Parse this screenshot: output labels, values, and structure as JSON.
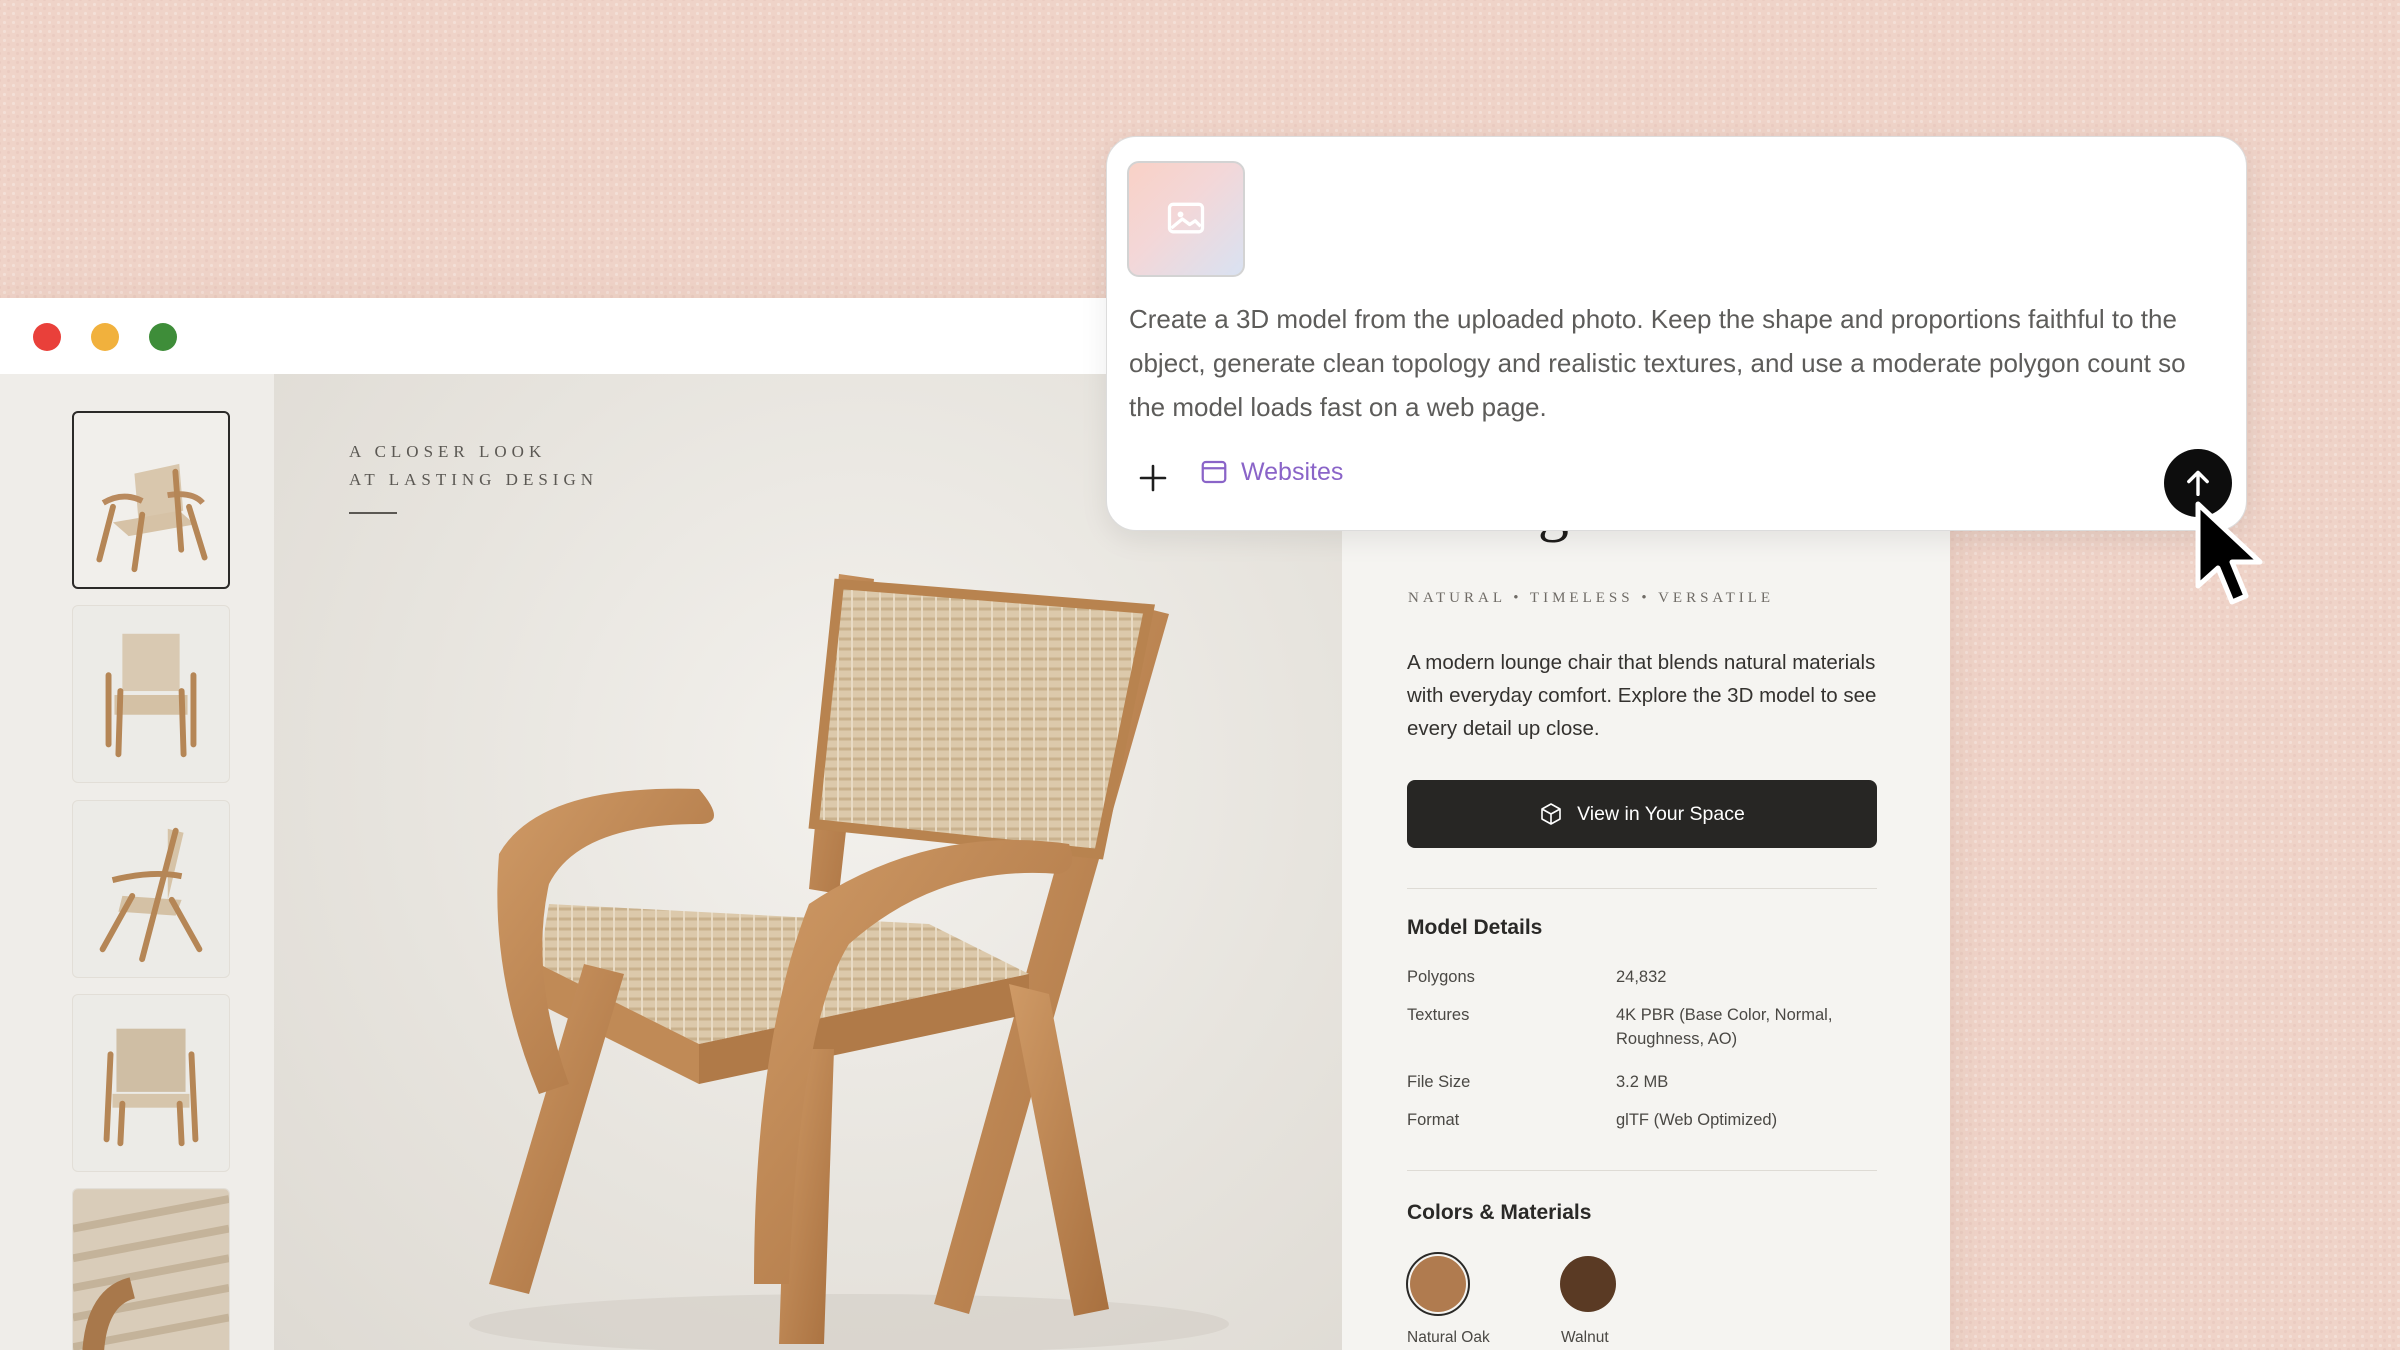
{
  "window": {
    "controls": [
      "close",
      "minimize",
      "maximize"
    ],
    "colors": {
      "close": "#e9403a",
      "minimize": "#f1b13d",
      "maximize": "#3e8d39"
    }
  },
  "gallery": {
    "thumbnails": [
      "front three-quarter view",
      "front view",
      "side view",
      "back view",
      "weave detail"
    ],
    "active_index": 0
  },
  "hero": {
    "eyebrow_line1": "A CLOSER LOOK",
    "eyebrow_line2": "AT LASTING DESIGN"
  },
  "product": {
    "title": "Lounge Chair",
    "tagline": "NATURAL • TIMELESS • VERSATILE",
    "description": "A modern lounge chair that blends natural materials with everyday comfort. Explore the 3D model to see every detail up close.",
    "cta_label": "View in Your Space",
    "model_details": {
      "title": "Model Details",
      "rows": [
        {
          "label": "Polygons",
          "value": "24,832"
        },
        {
          "label": "Textures",
          "value": "4K PBR (Base Color, Normal, Roughness, AO)"
        },
        {
          "label": "File Size",
          "value": "3.2 MB"
        },
        {
          "label": "Format",
          "value": "glTF (Web Optimized)"
        }
      ]
    },
    "colors_materials": {
      "title": "Colors & Materials",
      "options": [
        {
          "label": "Natural Oak",
          "color": "#b07b4f",
          "selected": true
        },
        {
          "label": "Walnut",
          "color": "#5a3a24",
          "selected": false
        }
      ]
    }
  },
  "prompt": {
    "attachment_icon": "image-icon",
    "text": "Create a 3D model from the uploaded photo. Keep the shape and proportions faithful to the object, generate clean topology and realistic textures, and use a moderate polygon count so the model loads fast on a web page.",
    "chip_label": "Websites",
    "chip_icon": "browser-window-icon",
    "add_icon": "plus-icon",
    "send_icon": "arrow-up-icon",
    "accent_color": "#8a64c8"
  }
}
